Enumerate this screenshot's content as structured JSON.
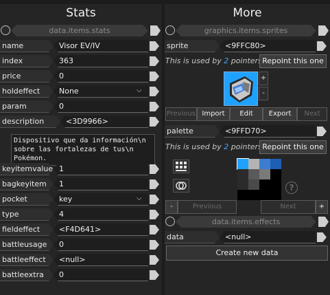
{
  "left": {
    "title": "Stats",
    "nav_label": "data.items.stats",
    "fields": [
      {
        "label": "name",
        "value": "Visor EV/IV"
      },
      {
        "label": "index",
        "value": "363"
      },
      {
        "label": "price",
        "value": "0"
      },
      {
        "label": "holdeffect",
        "value": "None"
      },
      {
        "label": "param",
        "value": "0"
      },
      {
        "label": "description",
        "value": "<3D9966>"
      }
    ],
    "description_text": "Dispositivo que da información\\n\nsobre las fortalezas de tus\\n\nPokémon.",
    "fields2": [
      {
        "label": "keyitemvalue",
        "value": "1"
      },
      {
        "label": "bagkeyitem",
        "value": "1"
      },
      {
        "label": "pocket",
        "value": "key"
      },
      {
        "label": "type",
        "value": "4"
      },
      {
        "label": "fieldeffect",
        "value": "<F4D641>"
      },
      {
        "label": "battleusage",
        "value": "0"
      },
      {
        "label": "battleeffect",
        "value": "<null>"
      },
      {
        "label": "battleextra",
        "value": "0"
      }
    ]
  },
  "right": {
    "title": "More",
    "sprites_nav_label": "graphics.items.sprites",
    "sprite_label": "sprite",
    "sprite_value": "<9FFC80>",
    "used_prefix": "This is used by",
    "used_count_sprite": "2",
    "used_suffix": "pointers.",
    "repoint_label": "Repoint this one",
    "plus": "+",
    "minus": "-",
    "previous_short": "Previous",
    "import_label": "Import",
    "edit_label": "Edit",
    "export_label": "Export",
    "next_short": "Next",
    "palette_label": "palette",
    "palette_value": "<9FFD70>",
    "used_count_palette": "2",
    "previous_label": "Previous",
    "next_label": "Next",
    "effects_nav_label": "data.items.effects",
    "data_label": "data",
    "data_value": "<null>",
    "create_label": "Create new data",
    "palette_colors": [
      "#1fa2ff",
      "#b4b4b4",
      "#3c7dd0",
      "#1e5eb4",
      "#2b2b2b",
      "#5a5a5a",
      "#7a7a7a",
      "#000000",
      "#2b2b2b",
      "#4a4a4a",
      "#000000",
      "#000000",
      "#000000",
      "#000000",
      "#000000",
      "#000000"
    ],
    "accent_color": "#3ea6ff"
  }
}
